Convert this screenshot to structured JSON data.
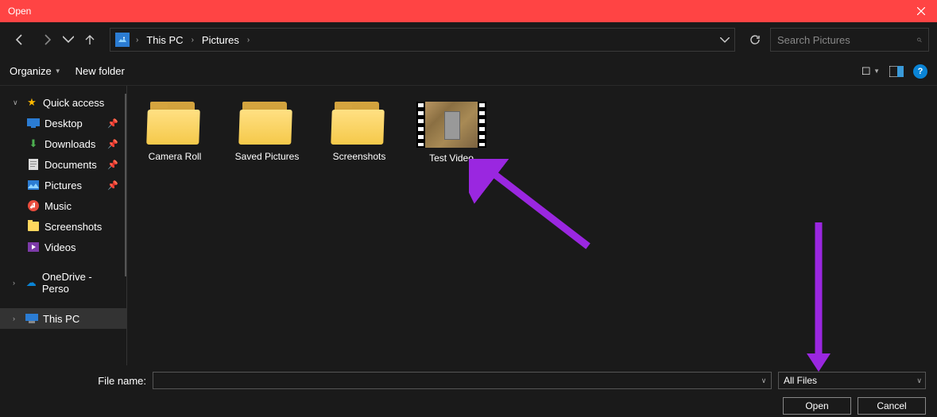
{
  "title": "Open",
  "breadcrumbs": [
    "This PC",
    "Pictures"
  ],
  "search_placeholder": "Search Pictures",
  "toolbar": {
    "organize": "Organize",
    "new_folder": "New folder"
  },
  "sidebar": {
    "quick_access": "Quick access",
    "items": [
      {
        "label": "Desktop",
        "pinned": true
      },
      {
        "label": "Downloads",
        "pinned": true
      },
      {
        "label": "Documents",
        "pinned": true
      },
      {
        "label": "Pictures",
        "pinned": true
      },
      {
        "label": "Music",
        "pinned": false
      },
      {
        "label": "Screenshots",
        "pinned": false
      },
      {
        "label": "Videos",
        "pinned": false
      }
    ],
    "onedrive": "OneDrive - Perso",
    "this_pc": "This PC"
  },
  "files": [
    {
      "name": "Camera Roll",
      "type": "folder"
    },
    {
      "name": "Saved Pictures",
      "type": "folder"
    },
    {
      "name": "Screenshots",
      "type": "folder"
    },
    {
      "name": "Test Video",
      "type": "video"
    }
  ],
  "footer": {
    "filename_label": "File name:",
    "filename_value": "",
    "filter": "All Files",
    "open": "Open",
    "cancel": "Cancel"
  }
}
